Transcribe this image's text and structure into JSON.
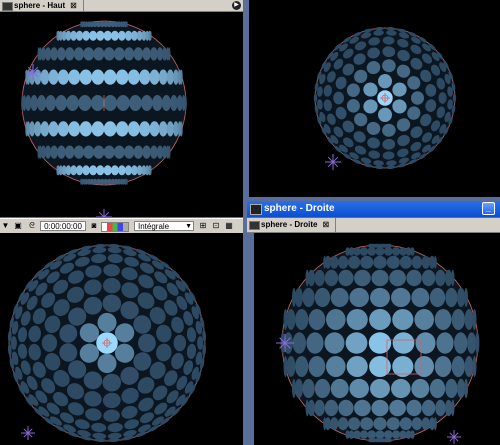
{
  "panels": {
    "top_left": {
      "tab_label": "sphere - Haut"
    },
    "bottom_right": {
      "window_title": "sphere - Droite",
      "tab_label": "sphere - Droite"
    }
  },
  "toolbar": {
    "timecode": "0:00:00:00",
    "resolution": "Intégrale"
  },
  "colors": {
    "viewport_bg": "#000000",
    "disc_dark": "#2e4a63",
    "disc_light": "#9ad8ff",
    "chrome": "#d4d0c8",
    "titlebar": "#0a4fd0",
    "guide": "#cc6666",
    "nav_star": "#8a6ad8"
  },
  "icons": [
    "tab-icon",
    "zoom-icon",
    "timecode-icon",
    "camera-icon",
    "color-channel-icon",
    "grid-icon",
    "dropdown-arrow-icon",
    "navigator-star-icon",
    "minimize-icon",
    "maximize-icon",
    "panel-menu-icon"
  ]
}
